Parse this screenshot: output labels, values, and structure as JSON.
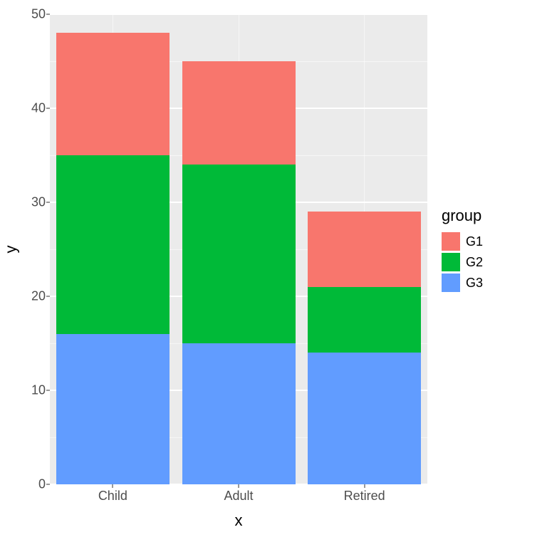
{
  "chart_data": {
    "type": "bar",
    "stacked": true,
    "categories": [
      "Child",
      "Adult",
      "Retired"
    ],
    "series": [
      {
        "name": "G1",
        "values": [
          13,
          11,
          8
        ],
        "color": "#F8766D"
      },
      {
        "name": "G2",
        "values": [
          19,
          19,
          7
        ],
        "color": "#00BA38"
      },
      {
        "name": "G3",
        "values": [
          16,
          15,
          14
        ],
        "color": "#619CFF"
      }
    ],
    "title": "",
    "xlabel": "x",
    "ylabel": "y",
    "ylim": [
      0,
      50
    ],
    "y_ticks": [
      0,
      10,
      20,
      30,
      40,
      50
    ],
    "y_minor_ticks": [
      5,
      15,
      25,
      35,
      45
    ],
    "legend_title": "group"
  }
}
